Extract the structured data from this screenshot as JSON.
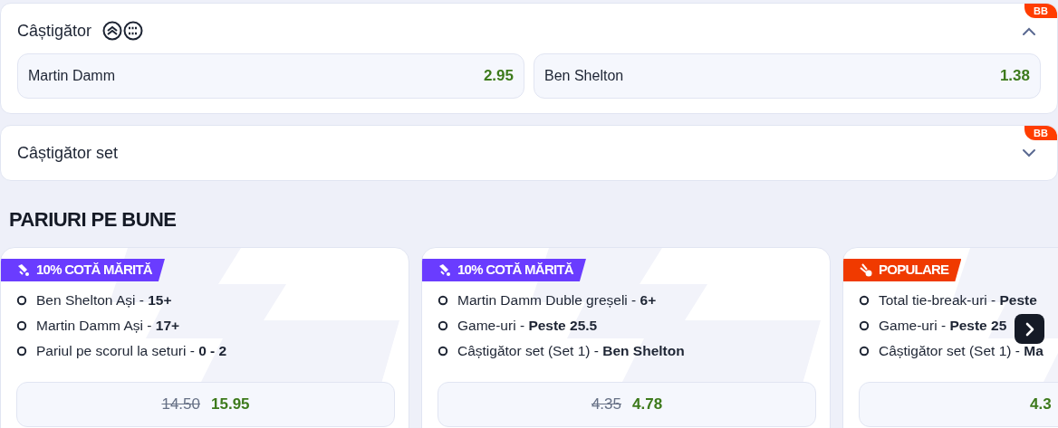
{
  "markets": [
    {
      "title": "Câștigător",
      "expanded": true,
      "badge": "BB",
      "show_icons": true,
      "selections": [
        {
          "name": "Martin Damm",
          "odds": "2.95"
        },
        {
          "name": "Ben Shelton",
          "odds": "1.38"
        }
      ]
    },
    {
      "title": "Câștigător set",
      "expanded": false,
      "badge": "BB",
      "show_icons": false
    }
  ],
  "section_title": "PARIURI PE BUNE",
  "bet_cards": [
    {
      "tag": {
        "kind": "boost",
        "label": "10% COTĂ MĂRITĂ",
        "color": "#6a3cff"
      },
      "legs": [
        "Ben Shelton Ași - **15+**",
        "Martin Damm Ași - **17+**",
        "Pariul pe scorul la seturi - **0 - 2**"
      ],
      "old_odds": "14.50",
      "odds": "15.95"
    },
    {
      "tag": {
        "kind": "boost",
        "label": "10% COTĂ MĂRITĂ",
        "color": "#6a3cff"
      },
      "legs": [
        "Martin Damm Duble greșeli - **6+**",
        "Game-uri - **Peste 25.5**",
        "Câștigător set (Set 1) - **Ben Shelton**"
      ],
      "old_odds": "4.35",
      "odds": "4.78"
    },
    {
      "tag": {
        "kind": "popular",
        "label": "POPULARE",
        "color": "#f03a00"
      },
      "legs": [
        "Total tie-break-uri - **Peste**",
        "Game-uri - **Peste 25**",
        "Câștigător set (Set 1) - **Ma**"
      ],
      "odds": "4.3"
    }
  ]
}
